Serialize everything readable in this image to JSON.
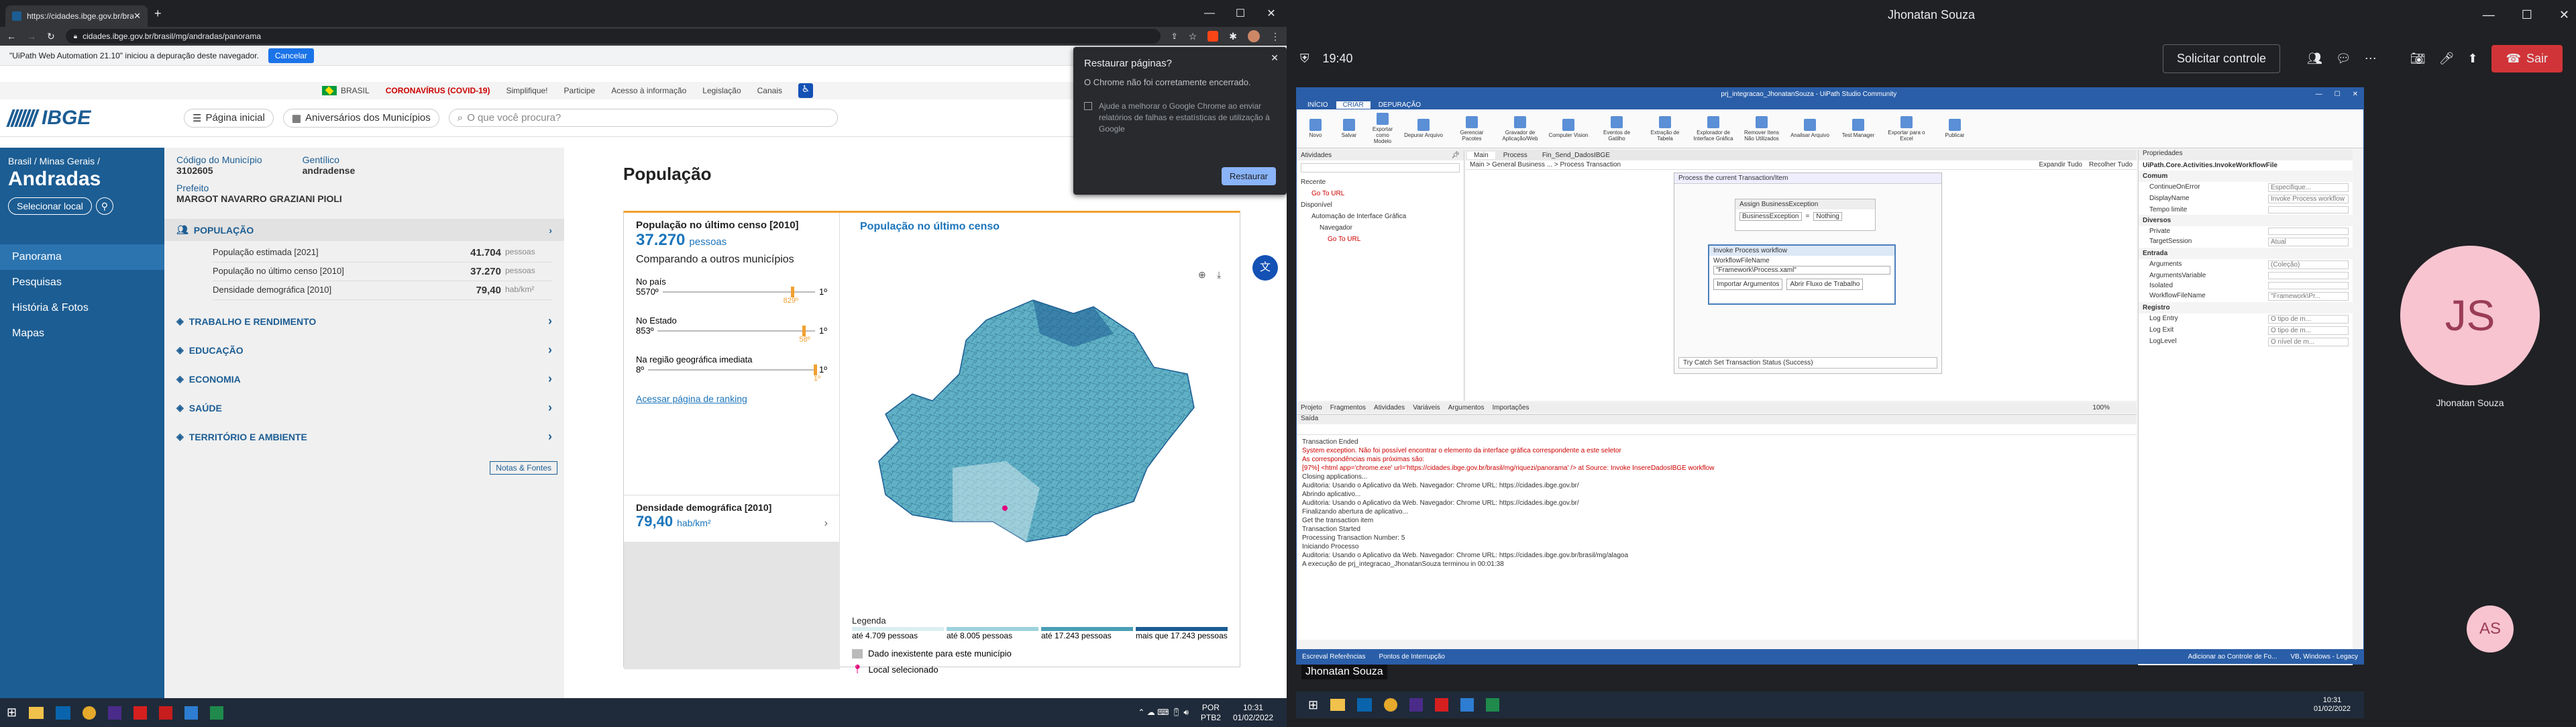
{
  "browser": {
    "tab_title": "https://cidades.ibge.gov.br/bras...",
    "new_tab": "+",
    "address": "cidades.ibge.gov.br/brasil/mg/andradas/panorama",
    "automation_notice": "\"UiPath Web Automation 21.10\" iniciou a depuração deste navegador.",
    "cancel_label": "Cancelar"
  },
  "gov_bar": {
    "country": "BRASIL",
    "items": [
      "CORONAVÍRUS (COVID-19)",
      "Simplifique!",
      "Participe",
      "Acesso à informação",
      "Legislação",
      "Canais"
    ]
  },
  "ibge": {
    "logo": "IBGE",
    "home": "Página inicial",
    "anniversary": "Aniversários dos Municípios",
    "search_placeholder": "O que você procura?"
  },
  "sidebar": {
    "breadcrumb": "Brasil / Minas Gerais /",
    "city": "Andradas",
    "select_location": "Selecionar local",
    "items": [
      "Panorama",
      "Pesquisas",
      "História & Fotos",
      "Mapas"
    ]
  },
  "info": {
    "code_label": "Código do Município",
    "code": "3102605",
    "gentilico_label": "Gentílico",
    "gentilico": "andradense",
    "prefeito_label": "Prefeito",
    "prefeito": "MARGOT NAVARRO GRAZIANI PIOLI",
    "populacao": "POPULAÇÃO",
    "rows": [
      {
        "label": "População estimada [2021]",
        "value": "41.704",
        "unit": "pessoas"
      },
      {
        "label": "População no último censo [2010]",
        "value": "37.270",
        "unit": "pessoas"
      },
      {
        "label": "Densidade demográfica [2010]",
        "value": "79,40",
        "unit": "hab/km²"
      }
    ],
    "sections": [
      "TRABALHO E RENDIMENTO",
      "EDUCAÇÃO",
      "ECONOMIA",
      "SAÚDE",
      "TERRITÓRIO E AMBIENTE"
    ],
    "notes": "Notas & Fontes"
  },
  "main": {
    "title": "População",
    "card_title": "População no último censo [2010]",
    "card_value": "37.270",
    "card_unit": "pessoas",
    "compare": "Comparando a outros municípios",
    "ranks": [
      {
        "label": "No país",
        "rank": "5570º",
        "top": "1º",
        "pos": "829º",
        "frac": 0.85
      },
      {
        "label": "No Estado",
        "rank": "853º",
        "top": "1º",
        "pos": "58º",
        "frac": 0.93
      },
      {
        "label": "Na região geográfica imediata",
        "rank": "8º",
        "top": "1º",
        "pos": "1º",
        "frac": 1.0
      }
    ],
    "ranking_link": "Acessar página de ranking",
    "density_title": "Densidade demográfica [2010]",
    "density_value": "79,40",
    "density_unit": "hab/km²",
    "map_title": "População no último censo",
    "legend_title": "Legenda",
    "legend": [
      "até 4.709 pessoas",
      "até 8.005 pessoas",
      "até 17.243 pessoas",
      "mais que 17.243 pessoas"
    ],
    "legend_colors": [
      "#dbeef2",
      "#9dd2dc",
      "#4a9fb6",
      "#1c5d93"
    ],
    "no_data": "Dado inexistente para este município",
    "selected": "Local selecionado"
  },
  "restore": {
    "title": "Restaurar páginas?",
    "body": "O Chrome não foi corretamente encerrado.",
    "check": "Ajude a melhorar o Google Chrome ao enviar relatórios de falhas e estatísticas de utilização à Google",
    "button": "Restaurar"
  },
  "taskbar": {
    "lang": "POR",
    "layout": "PTB2",
    "time": "10:31",
    "date": "01/02/2022"
  },
  "meet": {
    "user_top": "Jhonatan Souza",
    "time": "19:40",
    "control": "Solicitar controle",
    "leave": "Sair",
    "presenter": "Jhonatan Souza",
    "avatar_initials": "JS",
    "avatar_name": "Jhonatan Souza",
    "self_initials": "AS"
  },
  "uipath": {
    "title": "prj_integracao_JhonatanSouza - UiPath Studio Community",
    "ribbon_tabs": [
      "INÍCIO",
      "CRIAR",
      "DEPURAÇÃO"
    ],
    "ribbon_buttons": [
      "Novo",
      "Salvar",
      "Exportar como Modelo",
      "Depurar Arquivo",
      "Gerenciar Pacotes",
      "Gravador de Aplicação/Web",
      "Computer Vision",
      "Eventos de Gatilho",
      "Extração de Tabela",
      "Explorador de Interface Gráfica",
      "Remover Itens Não Utilizados",
      "Analisar Arquivo",
      "Test Manager",
      "Exportar para o Excel",
      "Publicar"
    ],
    "activities_title": "Atividades",
    "activity_tree": [
      "Recente",
      "Go To URL",
      "Disponível",
      "Automação de Interface Gráfica",
      "Navegador",
      "Go To URL"
    ],
    "doc_tabs": [
      "Main",
      "Process",
      "Fin_Send_DadosIBGE"
    ],
    "breadcrumb": "Main > General Business ... > Process Transaction",
    "expand": "Expandir Tudo",
    "collapse": "Recolher Tudo",
    "workflow": [
      "Process the current Transaction/Item",
      "Assign BusinessException",
      "BusinessException",
      "Nothing",
      "Invoke Process workflow",
      "WorkflowFileName",
      "\"Framework\\Process.xaml\"",
      "Importar Argumentos",
      "Abrir Fluxo de Trabalho",
      "Try Catch Set Transaction Status (Success)"
    ],
    "bottom_tabs": [
      "Projeto",
      "Fragmentos",
      "Atividades",
      "Variáveis",
      "Argumentos",
      "Importações"
    ],
    "zoom": "100%",
    "output_title": "Saída",
    "log": [
      "Transaction Ended",
      "System exception. Não foi possível encontrar o elemento da interface gráfica correspondente a este seletor",
      "As correspondências mais próximas são:",
      "[97%] <html app='chrome.exe' url='https://cidades.ibge.gov.br/brasil/mg/riquezi/panorama' /> at Source: Invoke InsereDadosIBGE workflow",
      "Closing applications...",
      "Auditoria: Usando o Aplicativo da Web. Navegador: Chrome URL: https://cidades.ibge.gov.br/",
      "Abrindo aplicativo...",
      "Auditoria: Usando o Aplicativo da Web. Navegador: Chrome URL: https://cidades.ibge.gov.br/",
      "Finalizando abertura de aplicativo...",
      "Get the transaction item",
      "Transaction Started",
      "Processing Transaction Number: 5",
      "Iniciando Processo",
      "Auditoria: Usando o Aplicativo da Web. Navegador: Chrome URL: https://cidades.ibge.gov.br/brasil/mg/alagoa",
      "A execução de prj_integracao_JhonatanSouza terminou in 00:01:38"
    ],
    "props_title": "Propriedades",
    "props_subtitle": "UiPath.Core.Activities.InvokeWorkflowFile",
    "props": [
      {
        "group": "Comum",
        "items": [
          "ContinueOnError",
          "DisplayName",
          "Tempo limite"
        ]
      },
      {
        "group": "Diversos",
        "items": [
          "Private",
          "TargetSession"
        ]
      },
      {
        "group": "Entrada",
        "items": [
          "Arguments",
          "ArgumentsVariable",
          "Isolated",
          "WorkflowFileName"
        ]
      },
      {
        "group": "Registro",
        "items": [
          "Log Entry",
          "Log Exit",
          "LogLevel"
        ]
      }
    ],
    "props_values": [
      "Especifique...",
      "Invoke Process workflow",
      "",
      "",
      "Atual",
      "(Coleção)",
      "",
      "",
      "\"Framework\\Pr...",
      "O tipo de m...",
      "O tipo de m...",
      "O nível de m..."
    ],
    "status_left": "Escreval Referências",
    "status_mid": "Pontos de Interrupção",
    "status_right": [
      "Adicionar ao Controle de Fo...",
      "VB, Windows - Legacy"
    ]
  }
}
